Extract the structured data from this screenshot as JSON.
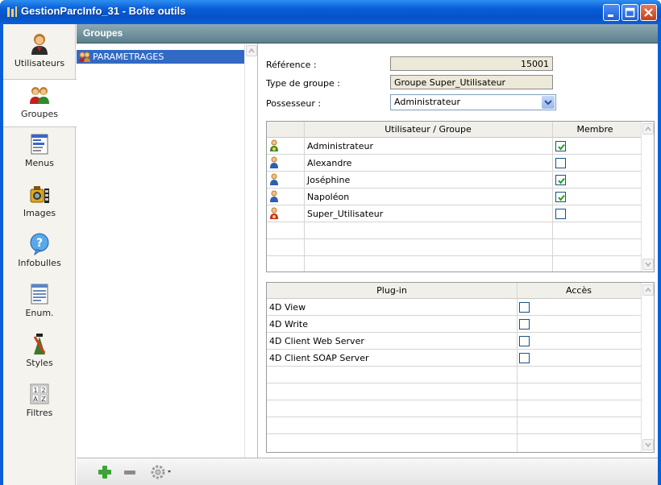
{
  "window": {
    "title": "GestionParcInfo_31 - Boîte outils"
  },
  "nav": {
    "items": [
      {
        "label": "Utilisateurs",
        "icon": "user-icon"
      },
      {
        "label": "Groupes",
        "icon": "group-icon",
        "selected": true
      },
      {
        "label": "Menus",
        "icon": "menus-icon"
      },
      {
        "label": "Images",
        "icon": "images-icon"
      },
      {
        "label": "Infobulles",
        "icon": "help-bubble-icon"
      },
      {
        "label": "Enum.",
        "icon": "list-icon"
      },
      {
        "label": "Styles",
        "icon": "styles-icon"
      },
      {
        "label": "Filtres",
        "icon": "filters-icon"
      }
    ]
  },
  "header": {
    "title": "Groupes"
  },
  "group_list": {
    "items": [
      {
        "label": "PARAMETRAGES",
        "selected": true
      }
    ]
  },
  "form": {
    "reference_label": "Référence :",
    "reference_value": "15001",
    "type_label": "Type de groupe :",
    "type_value": "Groupe Super_Utilisateur",
    "owner_label": "Possesseur :",
    "owner_value": "Administrateur"
  },
  "members_table": {
    "headers": [
      "Utilisateur / Groupe",
      "Membre"
    ],
    "rows": [
      {
        "name": "Administrateur",
        "member": true,
        "icon": "admin-user-icon"
      },
      {
        "name": "Alexandre",
        "member": false,
        "icon": "user-icon"
      },
      {
        "name": "Joséphine",
        "member": true,
        "icon": "user-icon"
      },
      {
        "name": "Napoléon",
        "member": true,
        "icon": "user-icon"
      },
      {
        "name": "Super_Utilisateur",
        "member": false,
        "icon": "super-user-icon"
      }
    ]
  },
  "plugins_table": {
    "headers": [
      "Plug-in",
      "Accès"
    ],
    "rows": [
      {
        "name": "4D View",
        "access": false
      },
      {
        "name": "4D Write",
        "access": false
      },
      {
        "name": "4D Client Web Server",
        "access": false
      },
      {
        "name": "4D Client SOAP Server",
        "access": false
      }
    ]
  },
  "colors": {
    "titlebar": "#0a5fd8",
    "selection": "#316ac5",
    "header_bar": "#6f8f9c"
  }
}
